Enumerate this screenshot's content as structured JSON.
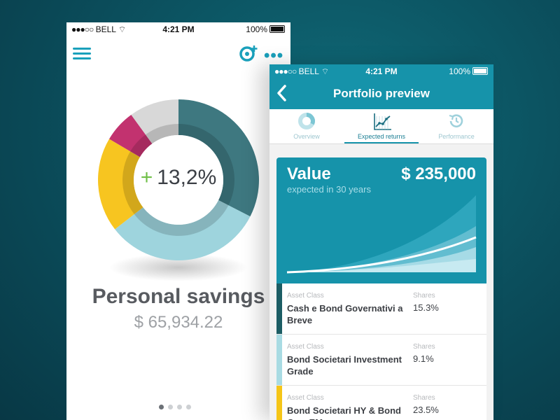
{
  "left_phone": {
    "status": {
      "carrier": "BELL",
      "time": "4:21 PM",
      "battery": "100%"
    },
    "center_value": "13,2%",
    "center_sign": "+",
    "title": "Personal savings",
    "amount": "$ 65,934.22",
    "page_dots": 4,
    "active_dot": 0,
    "donut": [
      {
        "share": 0.325,
        "color": "#3e7880"
      },
      {
        "share": 0.32,
        "color": "#9ed4dd"
      },
      {
        "share": 0.19,
        "color": "#f7c520"
      },
      {
        "share": 0.065,
        "color": "#c2326f"
      },
      {
        "share": 0.1,
        "color": "#d8d8d8"
      }
    ]
  },
  "right_phone": {
    "status": {
      "carrier": "BELL",
      "time": "4:21 PM",
      "battery": "100%"
    },
    "title": "Portfolio preview",
    "tabs": [
      {
        "label": "Overview",
        "icon": "donut-icon",
        "active": false
      },
      {
        "label": "Expected returns",
        "icon": "chart-icon",
        "active": true
      },
      {
        "label": "Performance",
        "icon": "history-icon",
        "active": false
      }
    ],
    "value_card": {
      "label": "Value",
      "amount": "$ 235,000",
      "subtitle": "expected in 30 years"
    },
    "assets": [
      {
        "class_label": "Asset Class",
        "name": "Cash e Bond Governativi a Breve",
        "shares_label": "Shares",
        "shares": "15.3%",
        "color": "#1c5d64"
      },
      {
        "class_label": "Asset Class",
        "name": "Bond Societari Investment Grade",
        "shares_label": "Shares",
        "shares": "9.1%",
        "color": "#a9dbe3"
      },
      {
        "class_label": "Asset Class",
        "name": "Bond Societari HY & Bond Gov. EM",
        "shares_label": "Shares",
        "shares": "23.5%",
        "color": "#f5c518"
      }
    ]
  },
  "colors": {
    "accent": "#1693aa",
    "background": "#0b4d5b"
  }
}
